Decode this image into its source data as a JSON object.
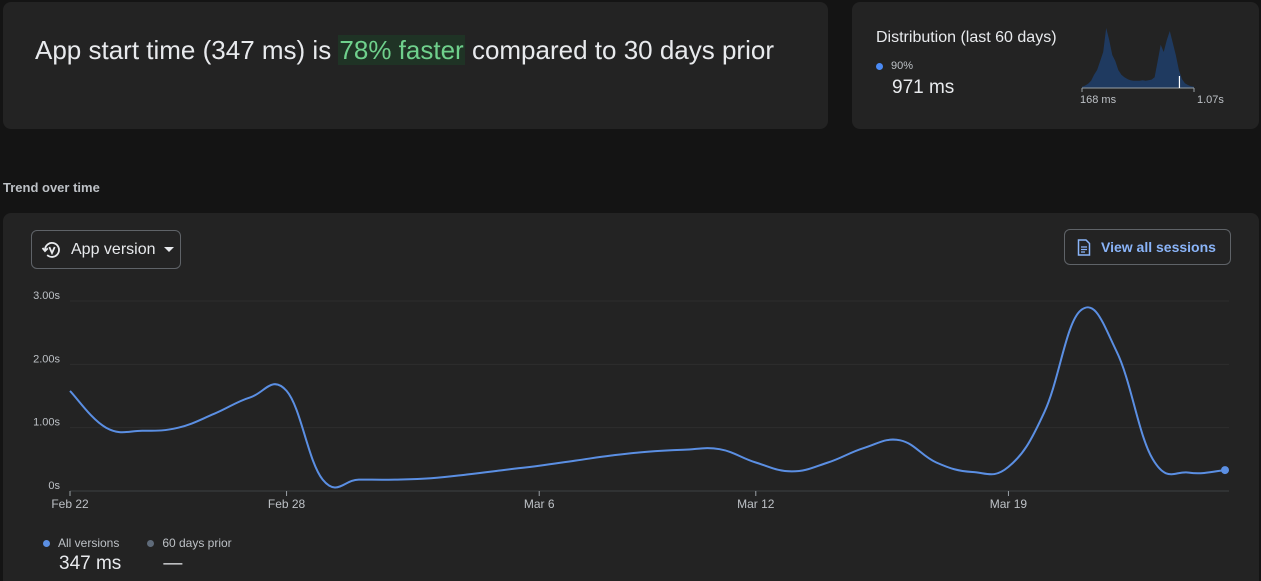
{
  "summary": {
    "prefix": "App start time (347 ms) is ",
    "highlight": "78% faster",
    "suffix": " compared to 30 days prior"
  },
  "distribution": {
    "title": "Distribution (last 60 days)",
    "percentile_label": "90%",
    "percentile_value": "971 ms",
    "min_label": "168 ms",
    "max_label": "1.07s",
    "marker_position": 0.87,
    "density": [
      0.02,
      0.04,
      0.07,
      0.12,
      0.22,
      0.3,
      0.45,
      0.6,
      1.0,
      0.8,
      0.55,
      0.45,
      0.3,
      0.22,
      0.18,
      0.15,
      0.13,
      0.12,
      0.12,
      0.12,
      0.13,
      0.12,
      0.13,
      0.14,
      0.18,
      0.45,
      0.72,
      0.6,
      0.8,
      0.95,
      0.75,
      0.55,
      0.3,
      0.15,
      0.08,
      0.05,
      0.03,
      0.02
    ],
    "series_color": "#1e3a5f",
    "marker_color": "#ffffff"
  },
  "trend": {
    "heading": "Trend over time",
    "version_button": "App version",
    "version_icon": "version-history-icon",
    "sessions_button": "View all sessions",
    "sessions_icon": "document-icon"
  },
  "chart_data": {
    "type": "line",
    "x_ticks": [
      "Feb 22",
      "Feb 28",
      "Mar 6",
      "Mar 12",
      "Mar 19"
    ],
    "y_ticks": [
      "0s",
      "1.00s",
      "2.00s",
      "3.00s"
    ],
    "ylim": [
      0,
      3.0
    ],
    "xlim": [
      "Feb 22",
      "Mar 25"
    ],
    "grid": true,
    "series": [
      {
        "name": "All versions",
        "color": "#5b8fe3",
        "x": [
          "Feb 22",
          "Feb 23",
          "Feb 24",
          "Feb 25",
          "Feb 26",
          "Feb 27",
          "Feb 28",
          "Feb 29",
          "Mar 1",
          "Mar 2",
          "Mar 3",
          "Mar 4",
          "Mar 5",
          "Mar 6",
          "Mar 7",
          "Mar 8",
          "Mar 9",
          "Mar 10",
          "Mar 11",
          "Mar 12",
          "Mar 13",
          "Mar 14",
          "Mar 15",
          "Mar 16",
          "Mar 17",
          "Mar 18",
          "Mar 19",
          "Mar 20",
          "Mar 21",
          "Mar 22",
          "Mar 23",
          "Mar 24",
          "Mar 25"
        ],
        "values": [
          1.58,
          1.0,
          0.95,
          1.0,
          1.22,
          1.48,
          1.58,
          0.18,
          0.18,
          0.18,
          0.2,
          0.26,
          0.33,
          0.4,
          0.48,
          0.56,
          0.62,
          0.65,
          0.66,
          0.45,
          0.31,
          0.45,
          0.68,
          0.8,
          0.45,
          0.3,
          0.38,
          1.25,
          2.85,
          2.2,
          0.5,
          0.29,
          0.33
        ]
      }
    ],
    "legend": [
      {
        "label": "All versions",
        "value": "347 ms",
        "color": "#5b8fe3"
      },
      {
        "label": "60 days prior",
        "value": "—",
        "color": "#5f6b7a"
      }
    ]
  }
}
